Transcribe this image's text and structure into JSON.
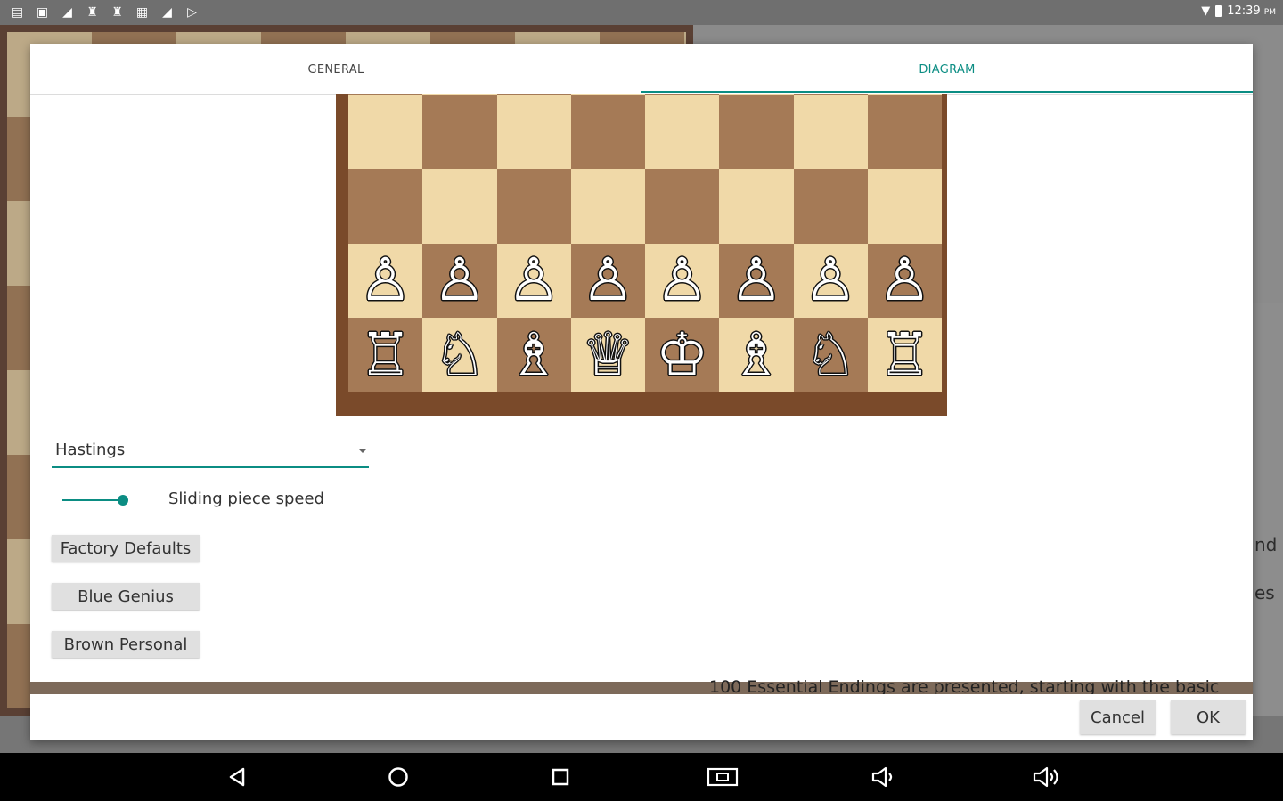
{
  "status_bar": {
    "time": "12:39",
    "ampm": "PM"
  },
  "background": {
    "right_text_1": "nd",
    "right_text_2": "es",
    "bottom_text": "100 Essential Endings are presented, starting with the basic"
  },
  "dialog": {
    "tabs": [
      {
        "label": "GENERAL",
        "selected": false
      },
      {
        "label": "DIAGRAM",
        "selected": true
      }
    ],
    "accent_color": "#0b8d83",
    "board": {
      "light_color": "#f0d9a8",
      "dark_color": "#a57a56",
      "border_color": "#7a4a2a",
      "pawns": [
        "♙",
        "♙",
        "♙",
        "♙",
        "♙",
        "♙",
        "♙",
        "♙"
      ],
      "back_rank": [
        "♖",
        "♘",
        "♗",
        "♕",
        "♔",
        "♗",
        "♘",
        "♖"
      ]
    },
    "piece_set": {
      "selected": "Hastings"
    },
    "slider": {
      "label": "Sliding piece speed",
      "value_fraction": 1.0
    },
    "buttons": {
      "factory": "Factory Defaults",
      "blue": "Blue Genius",
      "brown": "Brown Personal"
    },
    "actions": {
      "cancel": "Cancel",
      "ok": "OK"
    }
  },
  "nav_bar": {
    "icons": [
      "back-icon",
      "home-icon",
      "recents-icon",
      "screenshot-icon",
      "volume-down-icon",
      "volume-up-icon"
    ]
  }
}
